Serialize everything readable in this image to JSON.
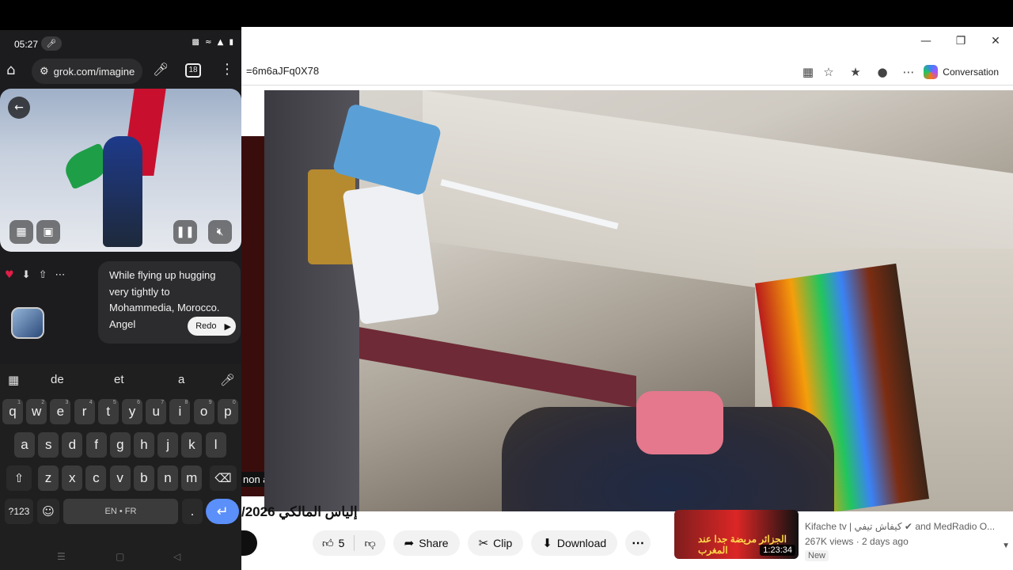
{
  "browser": {
    "url": "=6m6aJFq0X78",
    "conversation_label": "Conversation",
    "window_controls": [
      "minimize-icon",
      "restore-icon",
      "close-icon"
    ]
  },
  "video": {
    "title": "/2026 إلياس المالكي",
    "left_overlay_text": "non a",
    "actions": {
      "like_count": "5",
      "share": "Share",
      "clip": "Clip",
      "download": "Download"
    }
  },
  "recommendation": {
    "channel": "Kifache tv | كيفاش تيفي",
    "channel_suffix": "and MedRadio O...",
    "views": "267K views · 2 days ago",
    "badge": "New",
    "duration": "1:23:34",
    "thumb_text": "الجزائر مريضة جدا عند المغرب"
  },
  "phone": {
    "time": "05:27",
    "url": "grok.com/imagine",
    "tab_count": "18",
    "prompt": "While flying up hugging very tightly to Mohammedia, Morocco. Angel",
    "redo_label": "Redo",
    "suggestions": [
      "de",
      "et",
      "a"
    ],
    "keys_row1": [
      "q",
      "w",
      "e",
      "r",
      "t",
      "y",
      "u",
      "i",
      "o",
      "p"
    ],
    "keys_row1_nums": [
      "1",
      "2",
      "3",
      "4",
      "5",
      "6",
      "7",
      "8",
      "9",
      "0"
    ],
    "keys_row2": [
      "a",
      "s",
      "d",
      "f",
      "g",
      "h",
      "j",
      "k",
      "l"
    ],
    "keys_row3": [
      "z",
      "x",
      "c",
      "v",
      "b",
      "n",
      "m"
    ],
    "sym_label": "?123",
    "space_label": "EN • FR",
    "period": "."
  }
}
